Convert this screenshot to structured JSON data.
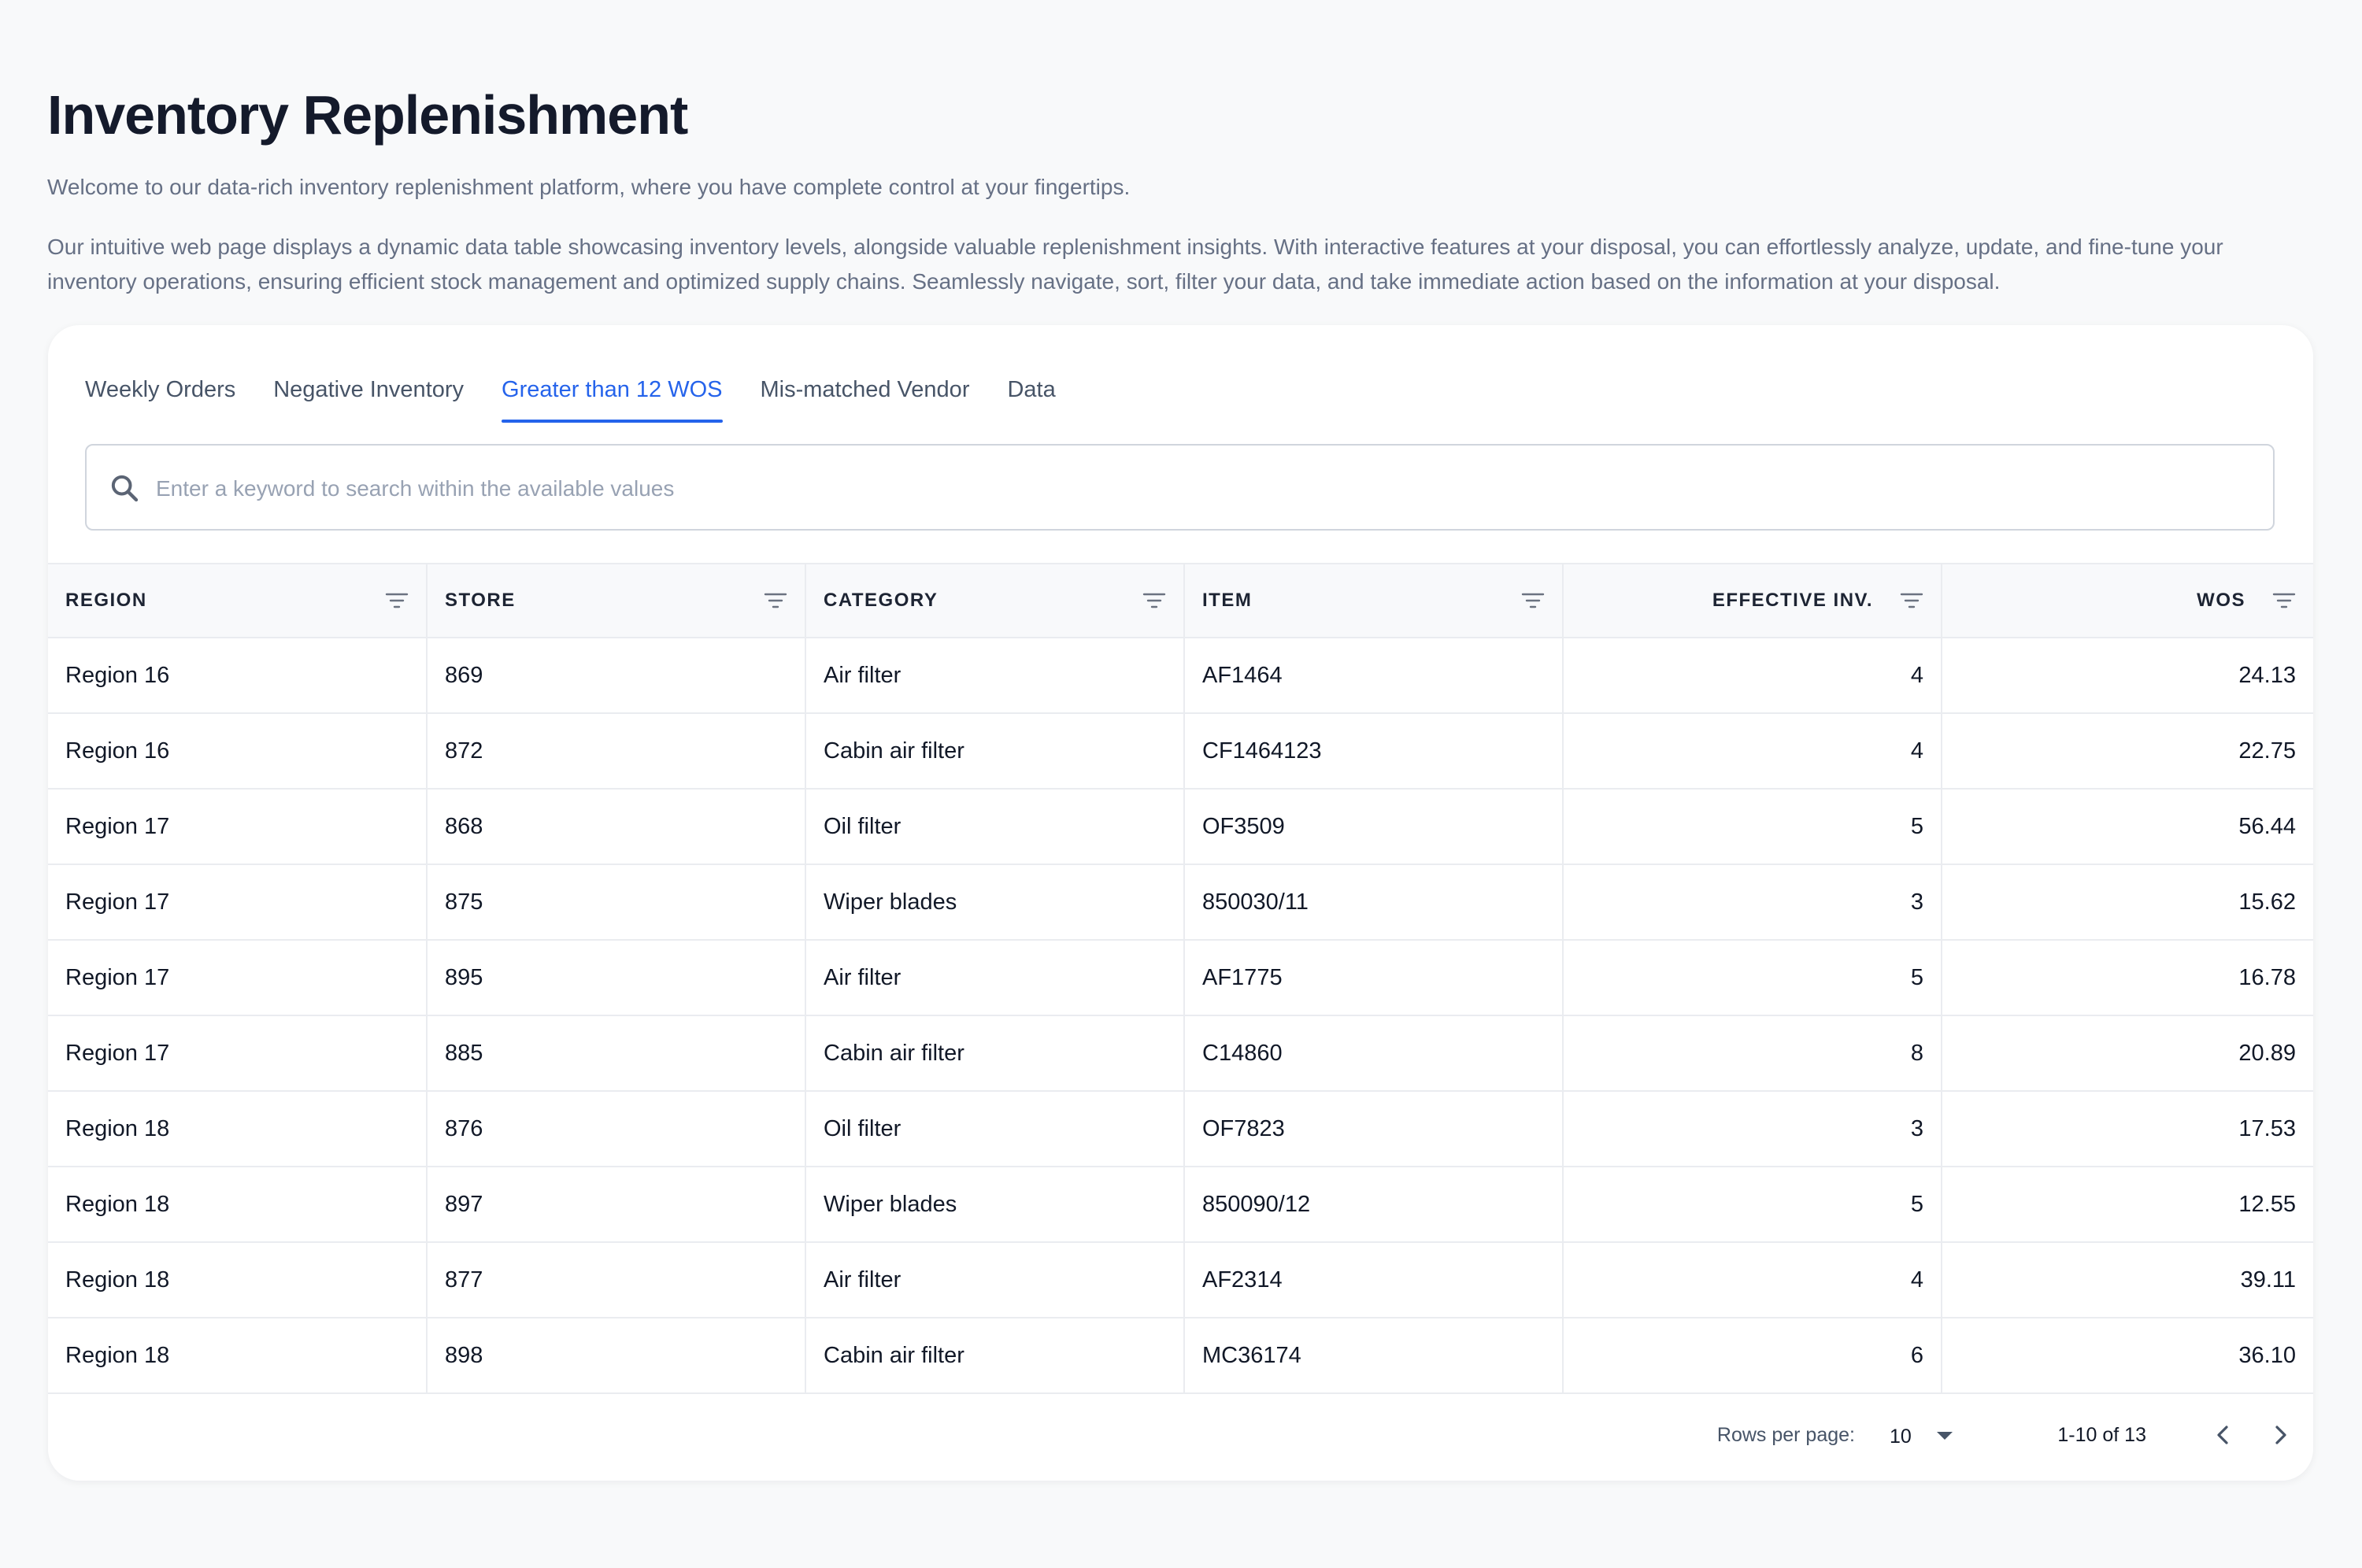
{
  "header": {
    "title": "Inventory Replenishment",
    "intro": "Welcome to our data-rich inventory replenishment platform, where you have complete control at your fingertips.",
    "description": "Our intuitive web page displays a dynamic data table showcasing inventory levels, alongside valuable replenishment insights. With interactive features at your disposal, you can effortlessly analyze, update, and fine-tune your inventory operations, ensuring efficient stock management and optimized supply chains. Seamlessly navigate, sort, filter your data, and take immediate action based on the information at your disposal."
  },
  "tabs": [
    {
      "label": "Weekly Orders"
    },
    {
      "label": "Negative Inventory"
    },
    {
      "label": "Greater than 12 WOS",
      "active": true
    },
    {
      "label": "Mis-matched Vendor"
    },
    {
      "label": "Data"
    }
  ],
  "search": {
    "placeholder": "Enter a keyword to search within the available values",
    "value": "",
    "icon": "search-icon"
  },
  "table": {
    "columns": [
      "REGION",
      "STORE",
      "CATEGORY",
      "ITEM",
      "EFFECTIVE INV.",
      "WOS"
    ],
    "rows": [
      [
        "Region 16",
        "869",
        "Air filter",
        "AF1464",
        "4",
        "24.13"
      ],
      [
        "Region 16",
        "872",
        "Cabin air filter",
        "CF1464123",
        "4",
        "22.75"
      ],
      [
        "Region 17",
        "868",
        "Oil filter",
        "OF3509",
        "5",
        "56.44"
      ],
      [
        "Region 17",
        "875",
        "Wiper blades",
        "850030/11",
        "3",
        "15.62"
      ],
      [
        "Region 17",
        "895",
        "Air filter",
        "AF1775",
        "5",
        "16.78"
      ],
      [
        "Region 17",
        "885",
        "Cabin air filter",
        "C14860",
        "8",
        "20.89"
      ],
      [
        "Region 18",
        "876",
        "Oil filter",
        "OF7823",
        "3",
        "17.53"
      ],
      [
        "Region 18",
        "897",
        "Wiper blades",
        "850090/12",
        "5",
        "12.55"
      ],
      [
        "Region 18",
        "877",
        "Air filter",
        "AF2314",
        "4",
        "39.11"
      ],
      [
        "Region 18",
        "898",
        "Cabin air filter",
        "MC36174",
        "6",
        "36.10"
      ]
    ]
  },
  "pagination": {
    "rows_per_page_label": "Rows per page:",
    "rows_per_page_value": "10",
    "range_label": "1-10 of 13"
  },
  "colors": {
    "accent": "#2563eb",
    "title": "#141a2b",
    "muted_text": "#667085",
    "border": "#eaecf0",
    "header_bg": "#f8f9fb",
    "page_bg": "#f8f9fa"
  }
}
